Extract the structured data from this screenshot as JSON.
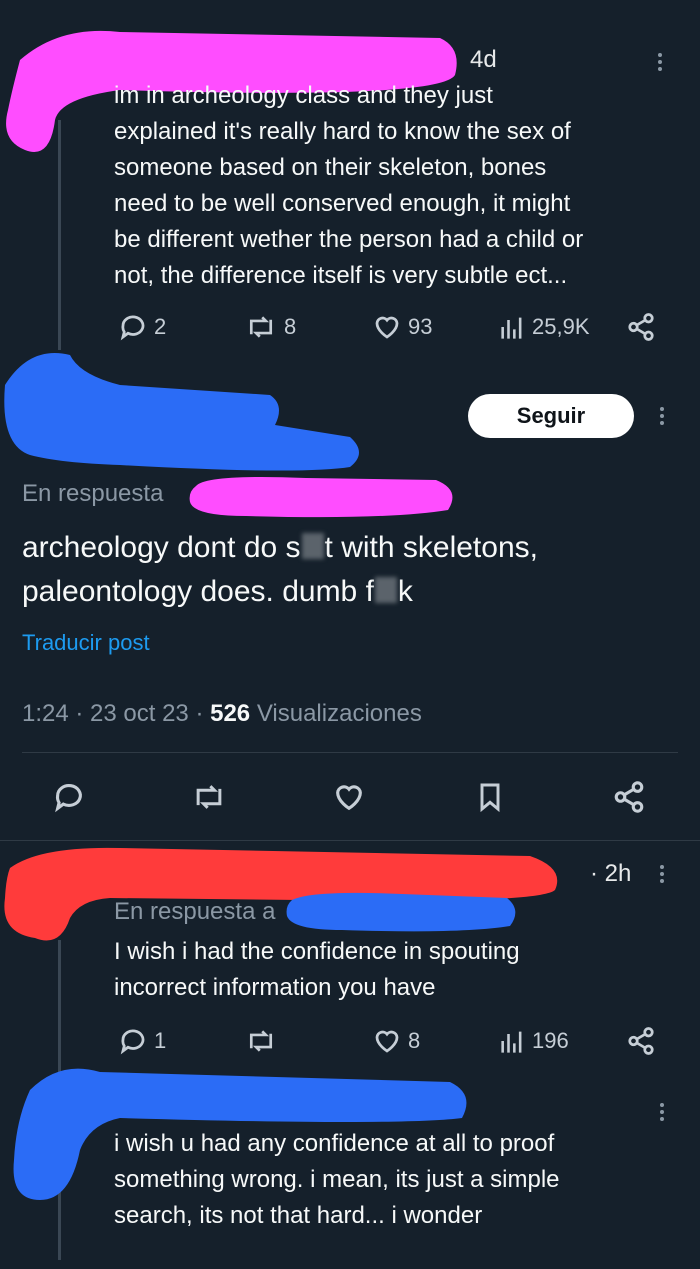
{
  "post1": {
    "time": "4d",
    "text_lines": [
      "im in archeology class and they just",
      "explained it's really hard to know the sex of",
      "someone based on their skeleton, bones",
      "need to be well conserved enough, it might",
      "be different wether the person had a child or",
      "not, the difference itself is very subtle ect..."
    ],
    "replies": "2",
    "reposts": "8",
    "likes": "93",
    "views": "25,9K"
  },
  "post2": {
    "follow_label": "Seguir",
    "in_reply_label": "En respuesta",
    "text_line1_a": "archeology dont do s",
    "text_line1_b": "t with skeletons,",
    "text_line2_a": "paleontology does. dumb f",
    "text_line2_b": "k",
    "translate_label": "Traducir post",
    "timestamp": "1:24 · 23 oct 23 · ",
    "views_count": "526",
    "views_label": " Visualizaciones"
  },
  "post3": {
    "time": "· 2h",
    "in_reply_label": "En respuesta a",
    "text_lines": [
      "I wish i had the confidence in spouting",
      "incorrect information you have"
    ],
    "replies": "1",
    "likes": "8",
    "views": "196"
  },
  "post4": {
    "text_lines": [
      "i wish u had any confidence at all to proof",
      "something wrong. i mean, its just a simple",
      "search, its not that hard... i wonder"
    ]
  },
  "colors": {
    "background": "#15202b",
    "accent": "#1d9bf0",
    "redaction_pink": "#ff4dff",
    "redaction_blue": "#2b6cf6",
    "redaction_red": "#ff3b3b"
  }
}
